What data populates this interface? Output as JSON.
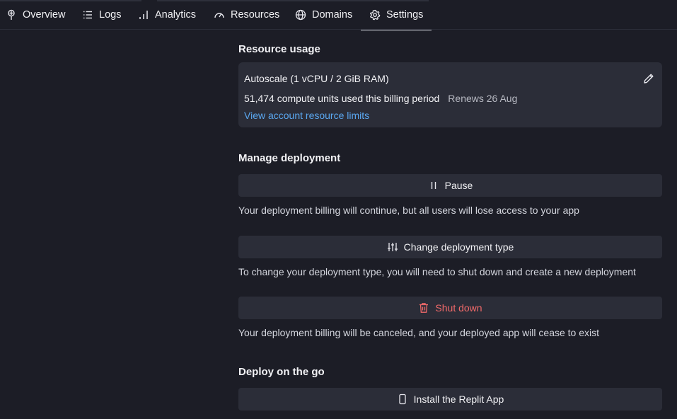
{
  "tabs": [
    {
      "label": "Overview",
      "icon": "overview-icon"
    },
    {
      "label": "Logs",
      "icon": "list-icon"
    },
    {
      "label": "Analytics",
      "icon": "bar-chart-icon"
    },
    {
      "label": "Resources",
      "icon": "gauge-icon"
    },
    {
      "label": "Domains",
      "icon": "globe-icon"
    },
    {
      "label": "Settings",
      "icon": "gear-icon",
      "active": true
    }
  ],
  "resource_usage": {
    "title": "Resource usage",
    "plan": "Autoscale (1 vCPU / 2 GiB RAM)",
    "usage": "51,474 compute units used this billing period",
    "renews": "Renews 26 Aug",
    "limits_link": "View account resource limits"
  },
  "manage": {
    "title": "Manage deployment",
    "pause_label": "Pause",
    "pause_desc": "Your deployment billing will continue, but all users will lose access to your app",
    "change_label": "Change deployment type",
    "change_desc": "To change your deployment type, you will need to shut down and create a new deployment",
    "shutdown_label": "Shut down",
    "shutdown_desc": "Your deployment billing will be canceled, and your deployed app will cease to exist"
  },
  "deploy_go": {
    "title": "Deploy on the go",
    "install_label": "Install the Replit App"
  },
  "colors": {
    "background": "#1c1d26",
    "surface": "#2b2d38",
    "link": "#5aa7f0",
    "danger": "#f26a6a"
  }
}
